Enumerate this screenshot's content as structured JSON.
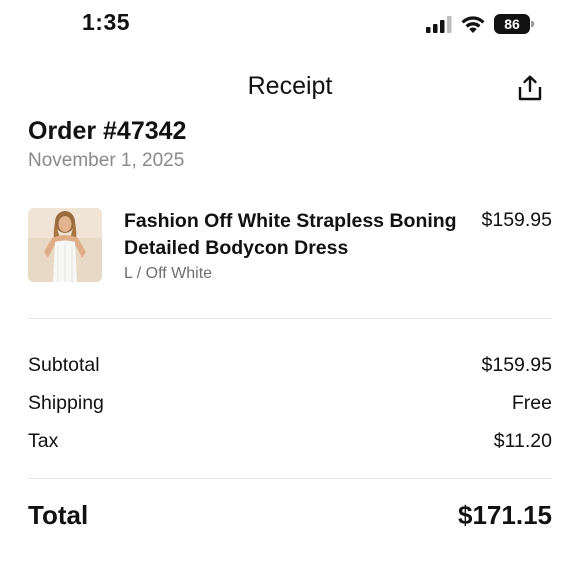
{
  "status_bar": {
    "time": "1:35",
    "battery_level": "86",
    "icons": [
      "cellular-signal-icon",
      "wifi-icon",
      "battery-icon"
    ]
  },
  "header": {
    "title": "Receipt",
    "share_icon": "share-icon"
  },
  "order": {
    "title": "Order #47342",
    "date": "November 1, 2025"
  },
  "item": {
    "name": "Fashion Off White Strapless Boning Detailed Bodycon Dress",
    "variant": "L / Off White",
    "price": "$159.95"
  },
  "summary": {
    "subtotal_label": "Subtotal",
    "subtotal_value": "$159.95",
    "shipping_label": "Shipping",
    "shipping_value": "Free",
    "tax_label": "Tax",
    "tax_value": "$11.20",
    "total_label": "Total",
    "total_value": "$171.15"
  },
  "colors": {
    "text": "#111111",
    "muted": "#8a8a8a",
    "divider": "#e6e6e6"
  }
}
